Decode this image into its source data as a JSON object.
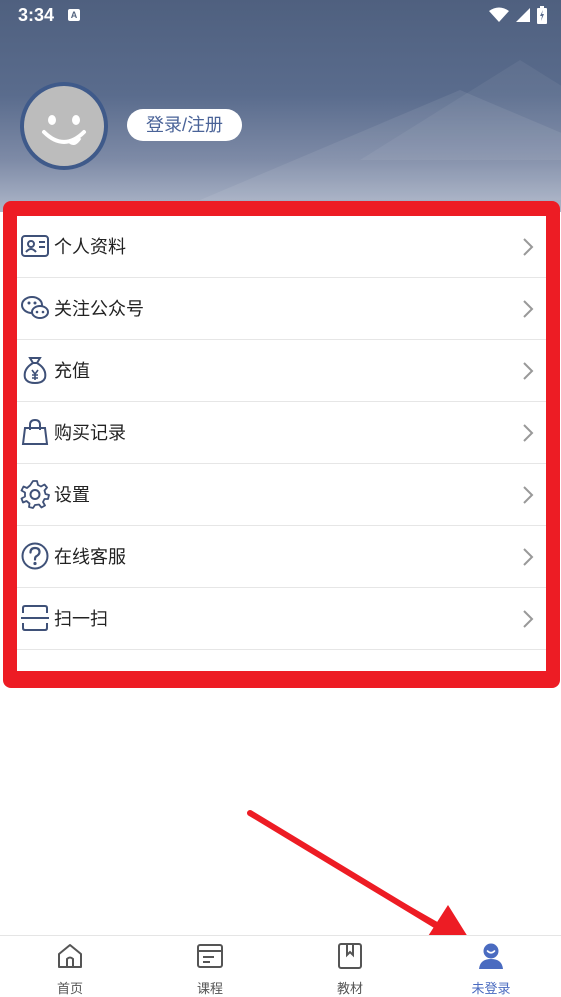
{
  "status_bar": {
    "time": "3:34",
    "notification_badge": "A"
  },
  "profile": {
    "login_label": "登录/注册"
  },
  "menu": {
    "items": [
      {
        "label": "个人资料",
        "icon": "id-card-icon"
      },
      {
        "label": "关注公众号",
        "icon": "wechat-icon"
      },
      {
        "label": "充值",
        "icon": "money-bag-icon"
      },
      {
        "label": "购买记录",
        "icon": "shopping-bag-icon"
      },
      {
        "label": "设置",
        "icon": "gear-icon"
      },
      {
        "label": "在线客服",
        "icon": "question-icon"
      },
      {
        "label": "扫一扫",
        "icon": "scan-icon"
      }
    ]
  },
  "bottom_nav": {
    "items": [
      {
        "label": "首页",
        "icon": "home-icon",
        "active": false
      },
      {
        "label": "课程",
        "icon": "course-icon",
        "active": false
      },
      {
        "label": "教材",
        "icon": "book-icon",
        "active": false
      },
      {
        "label": "未登录",
        "icon": "user-icon",
        "active": true
      }
    ]
  },
  "colors": {
    "header": "#5a6c8d",
    "highlight_frame": "#ed1c24",
    "accent": "#4a6bc0",
    "login_text": "#4a6398"
  }
}
